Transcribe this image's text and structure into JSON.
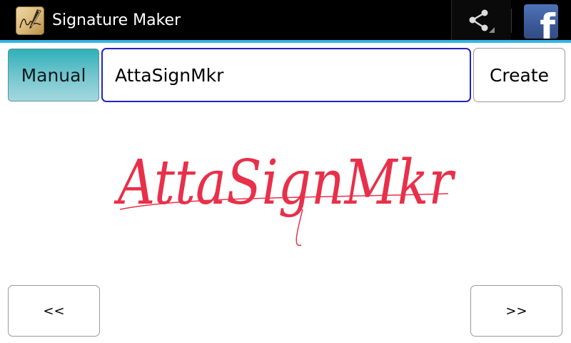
{
  "action_bar": {
    "title": "Signature Maker",
    "app_icon": "signature-quill-icon",
    "share_icon": "share-icon",
    "facebook_icon": "facebook-icon",
    "facebook_glyph": "f",
    "accent_color": "#33b5e5",
    "facebook_color": "#3b5998"
  },
  "input_row": {
    "manual_label": "Manual",
    "name_value": "AttaSignMkr",
    "create_label": "Create"
  },
  "signature": {
    "text": "AttaSignMkr",
    "ink_color": "#e8304a"
  },
  "navigation": {
    "prev_label": "<<",
    "next_label": ">>"
  }
}
